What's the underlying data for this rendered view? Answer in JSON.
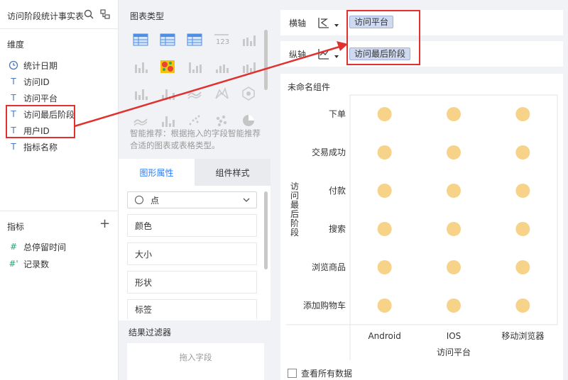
{
  "left": {
    "dataset_title": "访问阶段统计事实表",
    "dimension_title": "维度",
    "dimensions": [
      {
        "icon": "clock-icon",
        "label": "统计日期"
      },
      {
        "icon": "text-type-icon",
        "label": "访问ID"
      },
      {
        "icon": "text-type-icon",
        "label": "访问平台"
      },
      {
        "icon": "text-type-icon",
        "label": "访问最后阶段"
      },
      {
        "icon": "text-type-icon",
        "label": "用户ID"
      },
      {
        "icon": "text-type-icon",
        "label": "指标名称"
      }
    ],
    "measure_title": "指标",
    "measures": [
      {
        "icon": "number-type-icon",
        "label": "总停留时间"
      },
      {
        "icon": "record-count-icon",
        "label": "记录数"
      }
    ]
  },
  "middle": {
    "chart_type_title": "图表类型",
    "hint": "智能推荐：根据拖入的字段智能推荐合适的图表或表格类型。",
    "tab_graph_props": "图形属性",
    "tab_component_style": "组件样式",
    "mark_type": "点",
    "props": [
      "颜色",
      "大小",
      "形状",
      "标签"
    ],
    "filter_title": "结果过滤器",
    "filter_placeholder": "拖入字段"
  },
  "right": {
    "x_axis_label": "横轴",
    "x_axis_field": "访问平台",
    "y_axis_label": "纵轴",
    "y_axis_field": "访问最后阶段",
    "component_title": "未命名组件",
    "view_all_data": "查看所有数据"
  },
  "chart_data": {
    "type": "scatter",
    "categories_x": [
      "Android",
      "IOS",
      "移动浏览器"
    ],
    "categories_y": [
      "下单",
      "交易成功",
      "付款",
      "搜索",
      "浏览商品",
      "添加购物车"
    ],
    "xlabel": "访问平台",
    "ylabel": "访问最后阶段",
    "point_color": "#f7d38a",
    "points": "every x category × every y category"
  },
  "colors": {
    "accent": "#2e7cf6",
    "highlight_border": "#e0312f",
    "pill_bg": "#cfdaf1"
  }
}
